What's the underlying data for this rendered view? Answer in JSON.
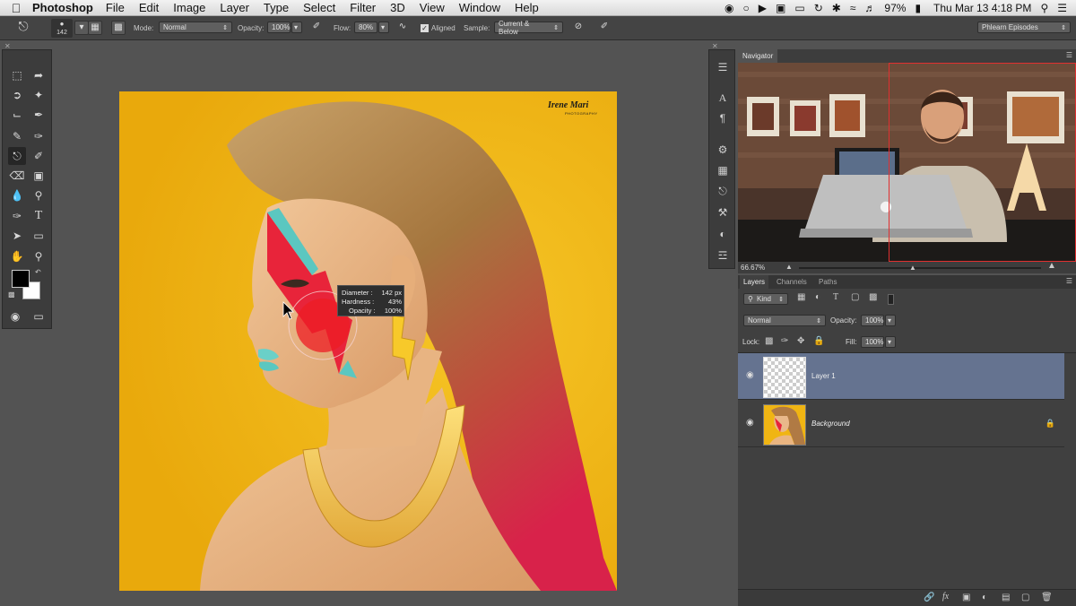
{
  "menubar": {
    "app_name": "Photoshop",
    "menus": [
      "File",
      "Edit",
      "Image",
      "Layer",
      "Type",
      "Select",
      "Filter",
      "3D",
      "View",
      "Window",
      "Help"
    ],
    "battery": "97%",
    "datetime": "Thu Mar 13  4:18 PM"
  },
  "options_bar": {
    "brush_size": "142",
    "mode_label": "Mode:",
    "mode_value": "Normal",
    "opacity_label": "Opacity:",
    "opacity_value": "100%",
    "flow_label": "Flow:",
    "flow_value": "80%",
    "aligned_label": "Aligned",
    "aligned_checked": true,
    "sample_label": "Sample:",
    "sample_value": "Current & Below",
    "workspace": "Phlearn Episodes"
  },
  "canvas": {
    "watermark_line1": "Irene Mari",
    "watermark_line2": "PHOTOGRAPHY"
  },
  "brush_tooltip": {
    "diameter_label": "Diameter :",
    "diameter_value": "142 px",
    "hardness_label": "Hardness :",
    "hardness_value": "43%",
    "opacity_label": "Opacity :",
    "opacity_value": "100%"
  },
  "navigator": {
    "title": "Navigator",
    "zoom": "66.67%"
  },
  "layers_panel": {
    "tabs": [
      "Layers",
      "Channels",
      "Paths"
    ],
    "filter_kind": "Kind",
    "blend_mode": "Normal",
    "opacity_label": "Opacity:",
    "opacity_value": "100%",
    "lock_label": "Lock:",
    "fill_label": "Fill:",
    "fill_value": "100%",
    "layers": [
      {
        "name": "Layer 1",
        "selected": true
      },
      {
        "name": "Background",
        "selected": false,
        "locked": true
      }
    ]
  },
  "colors": {
    "canvas_bg": "#f0b513",
    "selected_layer": "#657390",
    "app_bg": "#535353"
  }
}
